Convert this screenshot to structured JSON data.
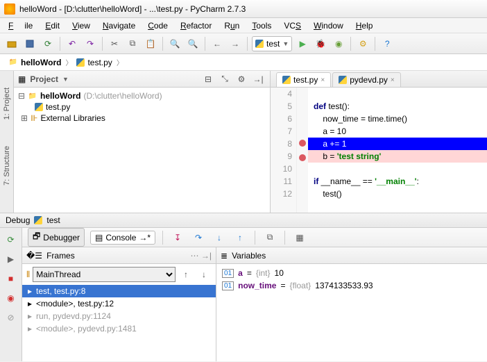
{
  "window": {
    "title": "helloWord - [D:\\clutter\\helloWord] - ...\\test.py - PyCharm 2.7.3"
  },
  "menu": {
    "file": "File",
    "edit": "Edit",
    "view": "View",
    "navigate": "Navigate",
    "code": "Code",
    "refactor": "Refactor",
    "run": "Run",
    "tools": "Tools",
    "vcs": "VCS",
    "window": "Window",
    "help": "Help"
  },
  "runconfig": {
    "name": "test"
  },
  "breadcrumb": {
    "root": "helloWord",
    "file": "test.py"
  },
  "sidetabs": {
    "project": "1: Project",
    "structure": "7: Structure"
  },
  "project": {
    "panel_title": "Project",
    "root": "helloWord",
    "root_path": "(D:\\clutter\\helloWord)",
    "file1": "test.py",
    "ext": "External Libraries"
  },
  "editor": {
    "tabs": [
      {
        "label": "test.py",
        "active": true
      },
      {
        "label": "pydevd.py",
        "active": false
      }
    ],
    "lines": {
      "4": "",
      "5": "def test():",
      "6": "    now_time = time.time()",
      "7": "    a = 10",
      "8": "    a += 1",
      "9": "    b = 'test string'",
      "10": "",
      "11": "if __name__ == '__main__':",
      "12": "    test()"
    },
    "breakpoints": [
      8,
      9
    ],
    "exec_line": 8
  },
  "debug": {
    "label": "Debug",
    "config": "test",
    "tabs": {
      "debugger": "Debugger",
      "console": "Console"
    },
    "frames": {
      "title": "Frames",
      "thread": "MainThread",
      "items": [
        {
          "label": "test, test.py:8",
          "sel": true
        },
        {
          "label": "<module>, test.py:12",
          "sel": false
        },
        {
          "label": "run, pydevd.py:1124",
          "sel": false,
          "dim": true
        },
        {
          "label": "<module>, pydevd.py:1481",
          "sel": false,
          "dim": true
        }
      ]
    },
    "vars": {
      "title": "Variables",
      "items": [
        {
          "name": "a",
          "type": "{int}",
          "value": "10"
        },
        {
          "name": "now_time",
          "type": "{float}",
          "value": "1374133533.93"
        }
      ]
    }
  }
}
